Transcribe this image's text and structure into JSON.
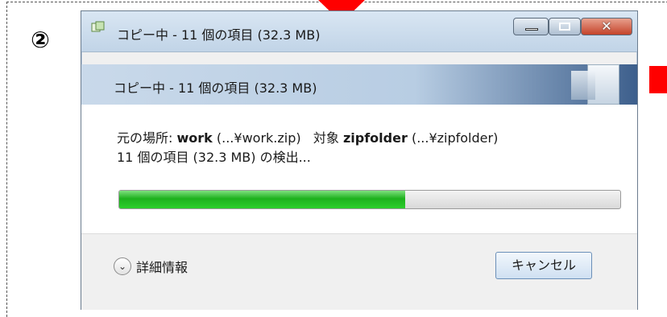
{
  "step_marker": "②",
  "window": {
    "title": "コピー中 - 11 個の項目 (32.3 MB)",
    "banner_title": "コピー中 - 11 個の項目 (32.3 MB)",
    "source_label": "元の場所: ",
    "source_name": "work",
    "source_path": " (...¥work.zip)",
    "target_label": "対象 ",
    "target_name": "zipfolder",
    "target_path": " (...¥zipfolder)",
    "status_line": "11 個の項目 (32.3 MB) の検出...",
    "progress": 0.57,
    "details_label": "詳細情報",
    "cancel_label": "キャンセル",
    "close_glyph": "✕",
    "chevron_glyph": "⌄",
    "icons": [
      "app-copy-icon",
      "minimize-icon",
      "maximize-icon",
      "close-icon",
      "chevron-down-icon"
    ]
  },
  "colors": {
    "progress_fill": "#1db11d",
    "marker_red": "#ff0000"
  }
}
